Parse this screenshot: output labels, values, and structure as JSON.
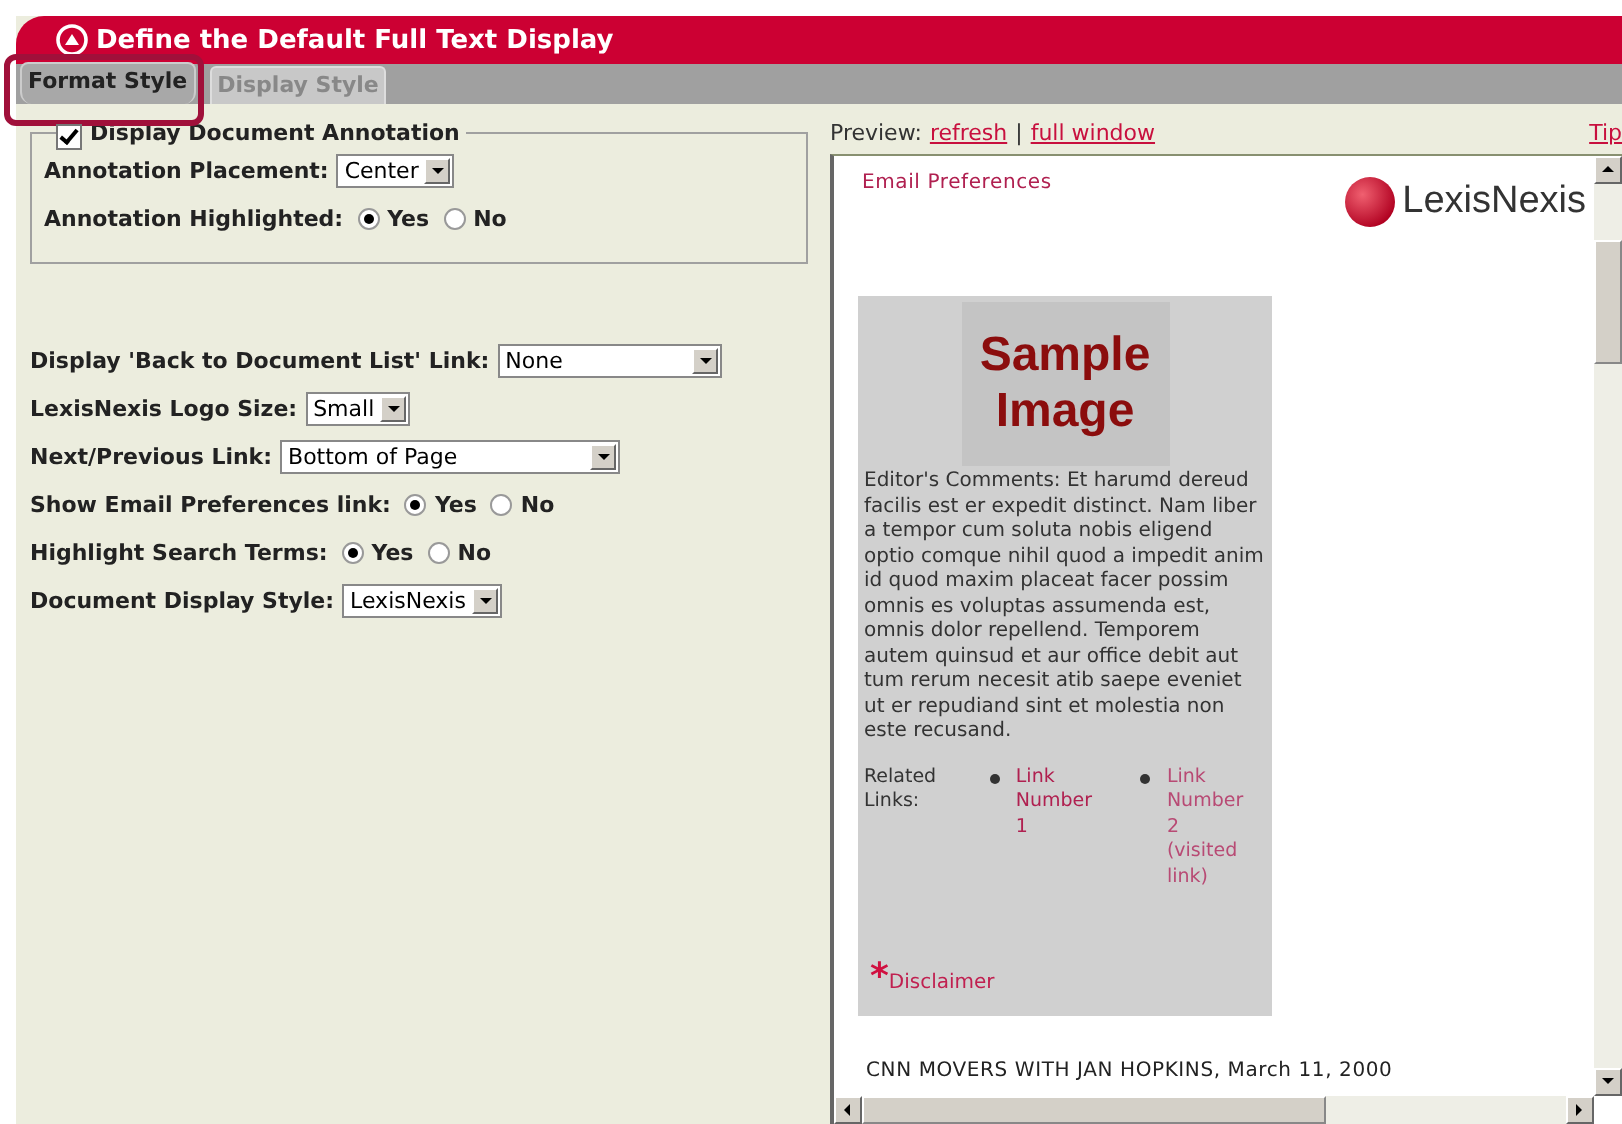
{
  "window": {
    "title": "Define the Default Full Text Display"
  },
  "tabs": [
    {
      "label": "Format Style",
      "selected": true,
      "outlined": true
    },
    {
      "label": "Display Style",
      "selected": false,
      "outlined": false
    }
  ],
  "annotation_group": {
    "label": "Display Document Annotation",
    "checked": true,
    "fields": [
      {
        "kind": "select",
        "label": "Annotation Placement:",
        "value": "Center"
      },
      {
        "kind": "radio",
        "label": "Annotation Highlighted:",
        "options": [
          {
            "label": "Yes",
            "selected": true
          },
          {
            "label": "No",
            "selected": false
          }
        ]
      }
    ]
  },
  "fields": [
    {
      "kind": "select",
      "label": "Display 'Back to Document List' Link:",
      "value": "None"
    },
    {
      "kind": "select",
      "label": "LexisNexis Logo Size:",
      "value": "Small"
    },
    {
      "kind": "select",
      "label": "Next/Previous Link:",
      "value": "Bottom of Page"
    },
    {
      "kind": "radio",
      "label": "Show Email Preferences link:",
      "options": [
        {
          "label": "Yes",
          "selected": true
        },
        {
          "label": "No",
          "selected": false
        }
      ]
    },
    {
      "kind": "radio",
      "label": "Highlight Search Terms:",
      "options": [
        {
          "label": "Yes",
          "selected": true
        },
        {
          "label": "No",
          "selected": false
        }
      ]
    },
    {
      "kind": "select",
      "label": "Document Display Style:",
      "value": "LexisNexis"
    }
  ],
  "preview": {
    "label": "Preview:",
    "links": [
      "refresh",
      "full window"
    ],
    "separator": "|",
    "tip": "Tip",
    "document": {
      "email_link": "Email Preferences",
      "logo_text": "LexisNexis",
      "sample_image": "Sample Image",
      "comments": "Editor's Comments: Et harumd dereud facilis est er expedit distinct. Nam liber a tempor cum soluta nobis eligend optio comque nihil quod a impedit anim id quod maxim placeat facer possim omnis es voluptas assumenda est, omnis dolor repellend. Temporem autem quinsud et aur office debit aut tum rerum necesit atib saepe eveniet ut er repudiand sint et molestia non este recusand.",
      "related_label": "Related Links:",
      "related_links": [
        {
          "label": "Link Number 1",
          "visited": false
        },
        {
          "label": "Link Number 2 (visited link)",
          "visited": true
        }
      ],
      "disclaimer_mark": "*",
      "disclaimer": "Disclaimer",
      "headline": "CNN MOVERS WITH JAN HOPKINS, March 11, 2000"
    }
  }
}
